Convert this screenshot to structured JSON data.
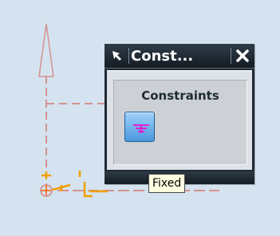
{
  "window": {
    "title": "Const...",
    "pin_icon": "pin-arrow-icon",
    "close_icon": "close-x-icon"
  },
  "group": {
    "label": "Constraints",
    "buttons": [
      {
        "id": "fixed",
        "icon": "fixed-ground-icon",
        "tooltip": "Fixed"
      }
    ]
  },
  "colors": {
    "background": "#d5e3f0",
    "sketch_curves": "#d4928f",
    "constraint_symbols": "#f0a000",
    "title_bar": "#1f2a33",
    "icon_button": "#4a98de",
    "icon_glyph": "#e020d0",
    "tooltip_bg": "#ffffe1"
  }
}
